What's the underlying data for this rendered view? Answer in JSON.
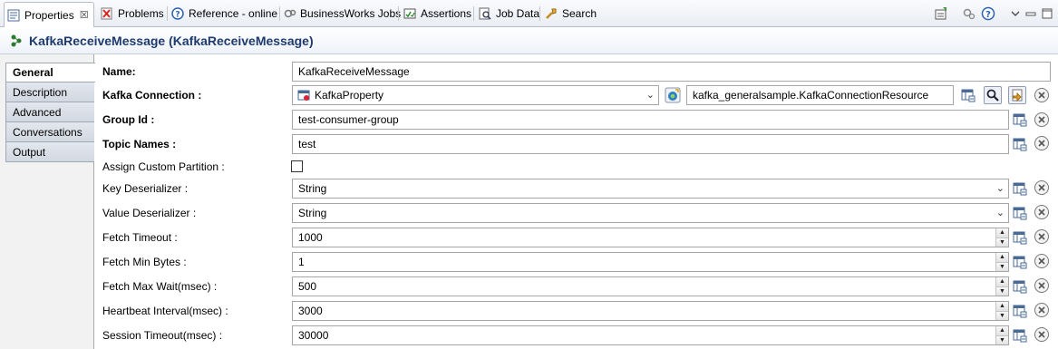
{
  "tabs": [
    {
      "label": "Properties",
      "icon": "properties-icon",
      "active": true,
      "close": "☒"
    },
    {
      "label": "Problems",
      "icon": "problems-icon"
    },
    {
      "label": "Reference - online",
      "icon": "help-icon"
    },
    {
      "label": "BusinessWorks Jobs",
      "icon": "jobs-icon"
    },
    {
      "label": "Assertions",
      "icon": "assertions-icon"
    },
    {
      "label": "Job Data",
      "icon": "job-data-icon"
    },
    {
      "label": "Search",
      "icon": "search-icon"
    }
  ],
  "header": {
    "title": "KafkaReceiveMessage (KafkaReceiveMessage)",
    "icon": "activity-icon"
  },
  "sidebar": {
    "items": [
      {
        "label": "General",
        "active": true
      },
      {
        "label": "Description"
      },
      {
        "label": "Advanced"
      },
      {
        "label": "Conversations"
      },
      {
        "label": "Output"
      }
    ]
  },
  "form": {
    "name": {
      "label": "Name:",
      "value": "KafkaReceiveMessage"
    },
    "kafka_connection": {
      "label": "Kafka Connection :",
      "value": "KafkaProperty",
      "resource": "kafka_generalsample.KafkaConnectionResource"
    },
    "group_id": {
      "label": "Group Id :",
      "value": "test-consumer-group"
    },
    "topic_names": {
      "label": "Topic Names :",
      "value": "test"
    },
    "assign_custom_partition": {
      "label": "Assign Custom Partition :",
      "checked": false
    },
    "key_deserializer": {
      "label": "Key Deserializer :",
      "value": "String"
    },
    "value_deserializer": {
      "label": "Value Deserializer :",
      "value": "String"
    },
    "fetch_timeout": {
      "label": "Fetch Timeout :",
      "value": "1000"
    },
    "fetch_min_bytes": {
      "label": "Fetch Min Bytes :",
      "value": "1"
    },
    "fetch_max_wait": {
      "label": "Fetch Max Wait(msec) :",
      "value": "500"
    },
    "heartbeat_interval": {
      "label": "Heartbeat Interval(msec) :",
      "value": "3000"
    },
    "session_timeout": {
      "label": "Session Timeout(msec) :",
      "value": "30000"
    }
  },
  "colors": {
    "title": "#1f3b6e",
    "accent": "#2a62b4"
  }
}
